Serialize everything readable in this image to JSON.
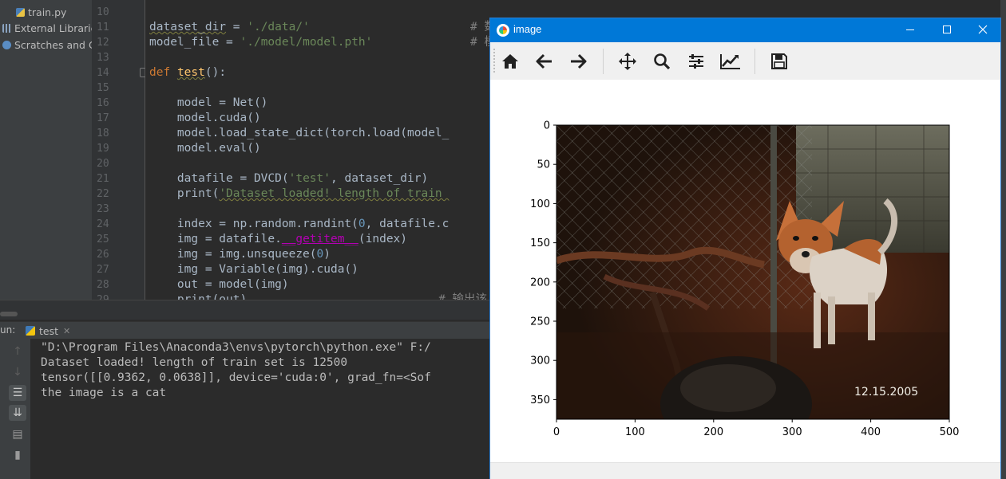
{
  "project_tree": {
    "items": [
      {
        "label": "train.py",
        "icon": "python-file-icon"
      },
      {
        "label": "External Libraries",
        "icon": "libraries-icon"
      },
      {
        "label": "Scratches and Consoles",
        "icon": "scratches-icon"
      }
    ]
  },
  "editor": {
    "line_numbers": [
      "10",
      "11",
      "12",
      "13",
      "14",
      "15",
      "16",
      "17",
      "18",
      "19",
      "20",
      "21",
      "22",
      "23",
      "24",
      "25",
      "26",
      "27",
      "28",
      "29"
    ],
    "lines": [
      {
        "kind": "blank"
      },
      {
        "kind": "assign",
        "var": "dataset_dir",
        "op": " = ",
        "str": "'./data/'",
        "comment": "# 数"
      },
      {
        "kind": "assign",
        "var": "model_file",
        "op": " = ",
        "str": "'./model/model.pth'",
        "comment": "# 模"
      },
      {
        "kind": "blank"
      },
      {
        "kind": "def",
        "kw": "def",
        "name": "test",
        "rest": "():"
      },
      {
        "kind": "blank"
      },
      {
        "kind": "plain",
        "text": "    model = Net()"
      },
      {
        "kind": "plain",
        "text": "    model.cuda()"
      },
      {
        "kind": "plain",
        "text": "    model.load_state_dict(torch.load(model_"
      },
      {
        "kind": "plain",
        "text": "    model.eval()"
      },
      {
        "kind": "blank"
      },
      {
        "kind": "call_str",
        "pre": "    datafile = DVCD(",
        "s1": "'test'",
        "mid": ", dataset_dir)"
      },
      {
        "kind": "print",
        "pre": "    print(",
        "str": "'Dataset loaded! length of train "
      },
      {
        "kind": "blank"
      },
      {
        "kind": "randint",
        "pre": "    index = np.random.randint(",
        "n": "0",
        "post": ", datafile.c"
      },
      {
        "kind": "magic",
        "pre": "    img = datafile.",
        "m": "__getitem__",
        "post": "(index)"
      },
      {
        "kind": "num",
        "pre": "    img = img.unsqueeze(",
        "n": "0",
        "post": ")"
      },
      {
        "kind": "plain",
        "text": "    img = Variable(img).cuda()"
      },
      {
        "kind": "plain",
        "text": "    out = model(img)"
      },
      {
        "kind": "cmt",
        "pre": "    print(out)",
        "comment": "# 输出该"
      }
    ]
  },
  "run": {
    "label": "un:",
    "tab": "test",
    "console_lines": [
      "\"D:\\Program Files\\Anaconda3\\envs\\pytorch\\python.exe\" F:/",
      "Dataset loaded! length of train set is 12500",
      "tensor([[0.9362, 0.0638]], device='cuda:0', grad_fn=<Sof",
      "the image is a cat"
    ],
    "side_buttons": [
      "up-arrow-icon",
      "down-arrow-icon",
      "soft-wrap-icon",
      "scroll-to-end-icon",
      "print-icon",
      "trash-icon"
    ]
  },
  "figure": {
    "title": "image",
    "toolbar": [
      "home-icon",
      "back-arrow-icon",
      "forward-arrow-icon",
      "move-icon",
      "zoom-icon",
      "configure-subplots-icon",
      "edit-curves-icon",
      "save-icon"
    ],
    "photo_caption": "12.15.2005",
    "y_ticks": [
      "0",
      "50",
      "100",
      "150",
      "200",
      "250",
      "300",
      "350"
    ],
    "x_ticks": [
      "0",
      "100",
      "200",
      "300",
      "400",
      "500"
    ],
    "x_range": [
      0,
      500
    ],
    "y_range": [
      0,
      375
    ]
  }
}
